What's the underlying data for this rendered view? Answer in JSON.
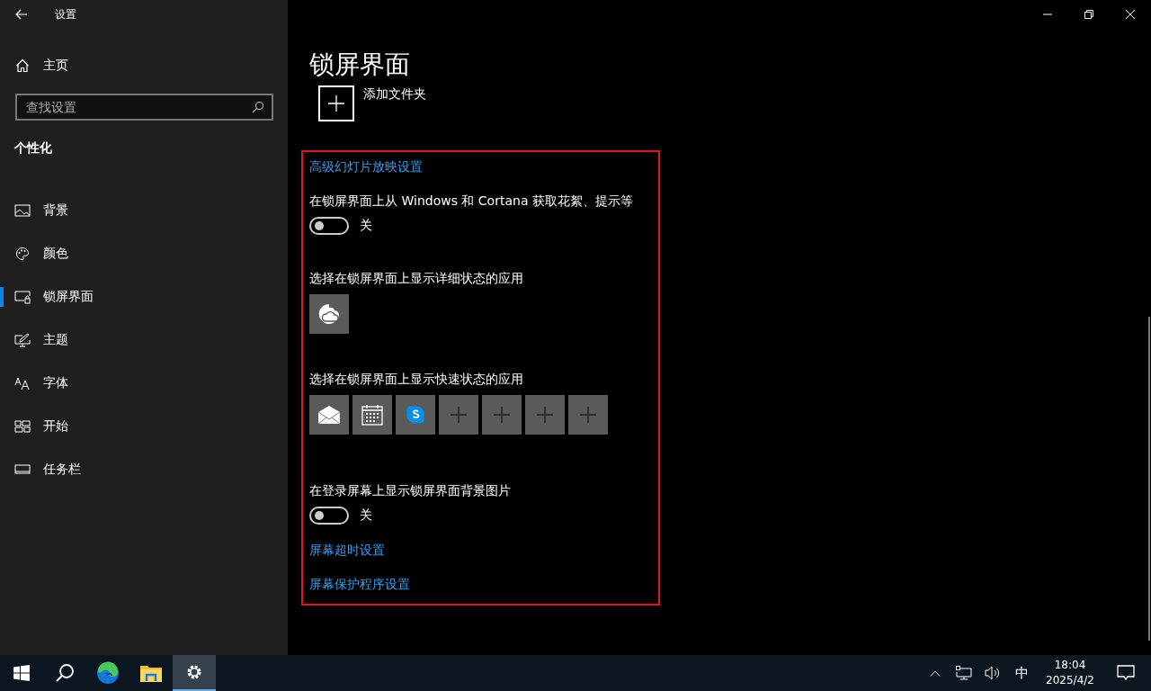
{
  "window": {
    "title": "设置"
  },
  "sidebar": {
    "home": "主页",
    "search": {
      "placeholder": "查找设置"
    },
    "section": "个性化",
    "items": [
      {
        "label": "背景",
        "selected": false
      },
      {
        "label": "颜色",
        "selected": false
      },
      {
        "label": "锁屏界面",
        "selected": true
      },
      {
        "label": "主题",
        "selected": false
      },
      {
        "label": "字体",
        "selected": false
      },
      {
        "label": "开始",
        "selected": false
      },
      {
        "label": "任务栏",
        "selected": false
      }
    ]
  },
  "page": {
    "title": "锁屏界面",
    "add_folder": "添加文件夹",
    "settings": [
      {
        "kind": "link",
        "label": "高级幻灯片放映设置"
      },
      {
        "kind": "toggle",
        "label": "在锁屏界面上从 Windows 和 Cortana 获取花絮、提示等",
        "on": false,
        "state_text": "关"
      },
      {
        "kind": "apps",
        "label": "选择在锁屏界面上显示详细状态的应用",
        "apps": [
          {
            "kind": "weather"
          }
        ]
      },
      {
        "kind": "apps",
        "label": "选择在锁屏界面上显示快速状态的应用",
        "apps": [
          {
            "kind": "mail"
          },
          {
            "kind": "calendar"
          },
          {
            "kind": "skype"
          },
          {
            "kind": "add"
          },
          {
            "kind": "add"
          },
          {
            "kind": "add"
          },
          {
            "kind": "add"
          }
        ]
      },
      {
        "kind": "toggle",
        "label": "在登录屏幕上显示锁屏界面背景图片",
        "on": false,
        "state_text": "关"
      },
      {
        "kind": "link",
        "label": "屏幕超时设置"
      },
      {
        "kind": "link",
        "label": "屏幕保护程序设置"
      }
    ]
  },
  "taskbar": {
    "apps": [
      {
        "kind": "search",
        "selected": false
      },
      {
        "kind": "edge",
        "selected": false
      },
      {
        "kind": "explorer",
        "selected": false
      },
      {
        "kind": "settings",
        "selected": true
      }
    ],
    "ime": "中",
    "time": "18:04",
    "date": "2025/4/2"
  }
}
